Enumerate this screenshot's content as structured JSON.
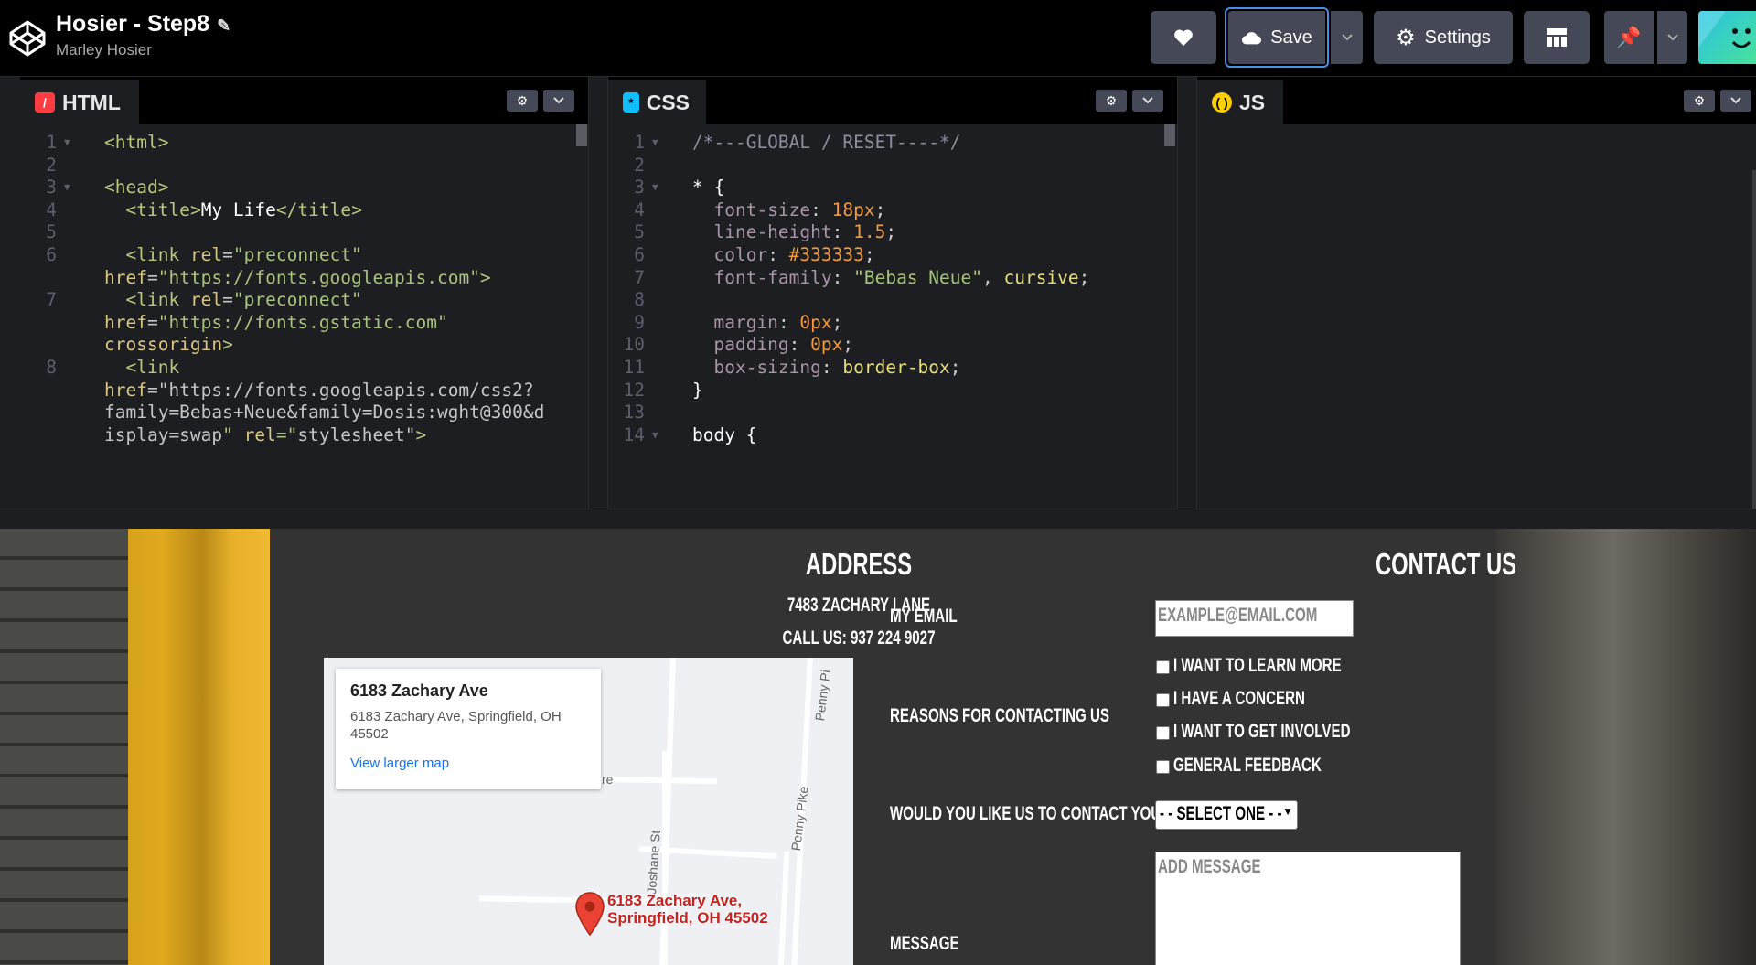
{
  "header": {
    "title": "Hosier - Step8",
    "author": "Marley Hosier",
    "save_label": "Save",
    "settings_label": "Settings",
    "edit_icon": "pencil-icon"
  },
  "editors": {
    "html": {
      "label": "HTML",
      "lines": [
        {
          "n": "1",
          "t": "<html>"
        },
        {
          "n": "2",
          "t": ""
        },
        {
          "n": "3",
          "t": "<head>"
        },
        {
          "n": "4",
          "t": "  <title>My Life</title>"
        },
        {
          "n": "5",
          "t": ""
        },
        {
          "n": "6",
          "t": "  <link rel=\"preconnect\""
        },
        {
          "n": "",
          "t": "href=\"https://fonts.googleapis.com\">"
        },
        {
          "n": "7",
          "t": "  <link rel=\"preconnect\""
        },
        {
          "n": "",
          "t": "href=\"https://fonts.gstatic.com\""
        },
        {
          "n": "",
          "t": "crossorigin>"
        },
        {
          "n": "8",
          "t": "  <link"
        },
        {
          "n": "",
          "t": "href=\"https://fonts.googleapis.com/css2?"
        },
        {
          "n": "",
          "t": "family=Bebas+Neue&family=Dosis:wght@300&d"
        },
        {
          "n": "",
          "t": "isplay=swap\" rel=\"stylesheet\">"
        }
      ]
    },
    "css": {
      "label": "CSS",
      "lines": [
        {
          "n": "1",
          "t": "/*---GLOBAL / RESET----*/"
        },
        {
          "n": "2",
          "t": ""
        },
        {
          "n": "3",
          "t": "* {"
        },
        {
          "n": "4",
          "t": "  font-size: 18px;"
        },
        {
          "n": "5",
          "t": "  line-height: 1.5;"
        },
        {
          "n": "6",
          "t": "  color: #333333;"
        },
        {
          "n": "7",
          "t": "  font-family: \"Bebas Neue\", cursive;"
        },
        {
          "n": "8",
          "t": ""
        },
        {
          "n": "9",
          "t": "  margin: 0px;"
        },
        {
          "n": "10",
          "t": "  padding: 0px;"
        },
        {
          "n": "11",
          "t": "  box-sizing: border-box;"
        },
        {
          "n": "12",
          "t": "}"
        },
        {
          "n": "13",
          "t": ""
        },
        {
          "n": "14",
          "t": "body {"
        }
      ]
    },
    "js": {
      "label": "JS",
      "lines": []
    }
  },
  "preview": {
    "address": {
      "heading": "ADDRESS",
      "street": "7483 ZACHARY LANE",
      "phone": "CALL US: 937 224 9027"
    },
    "map": {
      "place_title": "6183 Zachary Ave",
      "place_address": "6183 Zachary Ave, Springfield, OH 45502",
      "link": "View larger map",
      "pin_label_line1": "6183 Zachary Ave,",
      "pin_label_line2": "Springfield, OH 45502",
      "road_joshane": "Joshane St",
      "road_penny": "Penny Pike",
      "road_penny_top": "Penny Pi",
      "road_fragment": "re"
    },
    "contact": {
      "heading": "CONTACT US",
      "email_label": "MY EMAIL",
      "email_placeholder": "EXAMPLE@EMAIL.COM",
      "reasons_label": "REASONS FOR CONTACTING US",
      "reasons": [
        "I WANT TO LEARN MORE",
        "I HAVE A CONCERN",
        "I WANT TO GET INVOLVED",
        "GENERAL FEEDBACK"
      ],
      "contact_label": "WOULD YOU LIKE US TO CONTACT YOU?",
      "select_value": "- - SELECT ONE - -",
      "message_label": "MESSAGE",
      "message_placeholder": "ADD MESSAGE"
    }
  },
  "colors": {
    "html_icon": "#ff3c41",
    "css_icon": "#0ebeff",
    "js_icon": "#fcd000",
    "save_focus": "#4a8fe7",
    "button_bg": "#444857"
  }
}
